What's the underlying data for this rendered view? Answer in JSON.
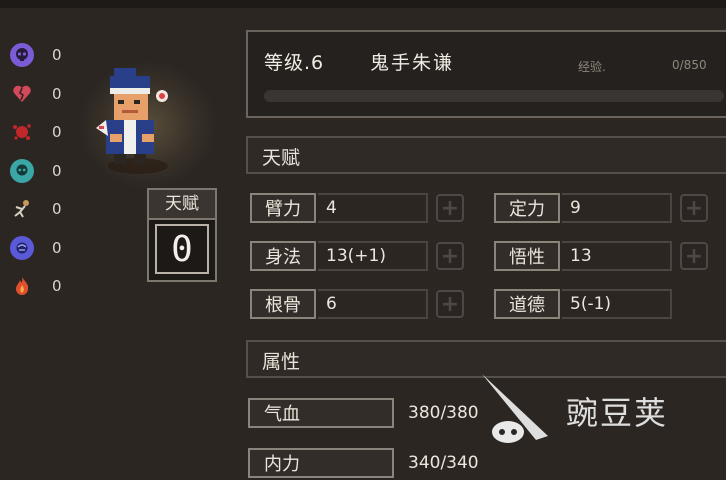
{
  "status_effects": [
    {
      "icon": "skull-icon",
      "color": "#7b5bd6",
      "value": "0"
    },
    {
      "icon": "broken-heart-icon",
      "color": "#d24a5a",
      "value": "0"
    },
    {
      "icon": "blood-splat-icon",
      "color": "#c0282c",
      "value": "0"
    },
    {
      "icon": "poison-skull-icon",
      "color": "#3aa6a6",
      "value": "0"
    },
    {
      "icon": "bound-figure-icon",
      "color": "#c89a5a",
      "value": "0"
    },
    {
      "icon": "dizzy-face-icon",
      "color": "#5a5ad8",
      "value": "0"
    },
    {
      "icon": "fire-icon",
      "color": "#e0502c",
      "value": "0"
    }
  ],
  "talent_badge": {
    "title": "天赋",
    "value": "0"
  },
  "header": {
    "level": "等级.6",
    "name": "鬼手朱谦",
    "exp_label": "经验.",
    "exp_value": "0/850",
    "exp_progress": 0
  },
  "sections": {
    "talent": "天赋",
    "attributes": "属性"
  },
  "stats": [
    {
      "label": "臂力",
      "value": "4"
    },
    {
      "label": "定力",
      "value": "9"
    },
    {
      "label": "身法",
      "value": "13(+1)"
    },
    {
      "label": "悟性",
      "value": "13"
    },
    {
      "label": "根骨",
      "value": "6"
    },
    {
      "label": "道德",
      "value": "5(-1)"
    }
  ],
  "attributes": [
    {
      "label": "气血",
      "value": "380/380"
    },
    {
      "label": "内力",
      "value": "340/340"
    }
  ],
  "watermark": {
    "text": "豌豆荚"
  }
}
